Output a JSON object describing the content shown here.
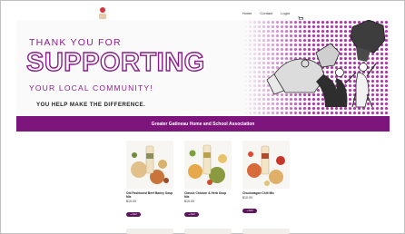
{
  "header": {
    "nav": [
      {
        "label": "Home"
      },
      {
        "label": "Contact"
      },
      {
        "label": "Login"
      }
    ]
  },
  "hero": {
    "line1": "THANK YOU FOR",
    "line2": "SUPPORTING",
    "line3": "YOUR LOCAL COMMUNITY!",
    "line4": "YOU HELP MAKE THE DIFFERENCE."
  },
  "banner": {
    "text": "Greater Gatineau Home and School Association"
  },
  "products": [
    {
      "name": "Old Fashioned Beef Barley Soup Mix",
      "price": "$10.00",
      "add_label": "+ Add"
    },
    {
      "name": "Classic Chicken & Herb Soup Mix",
      "price": "$10.00",
      "add_label": "+ Add"
    },
    {
      "name": "Chuckwagon Chili Mix",
      "price": "$10.00",
      "add_label": "+ Add"
    }
  ],
  "colors": {
    "brand_purple": "#7d157c",
    "button_purple": "#5d145c"
  }
}
